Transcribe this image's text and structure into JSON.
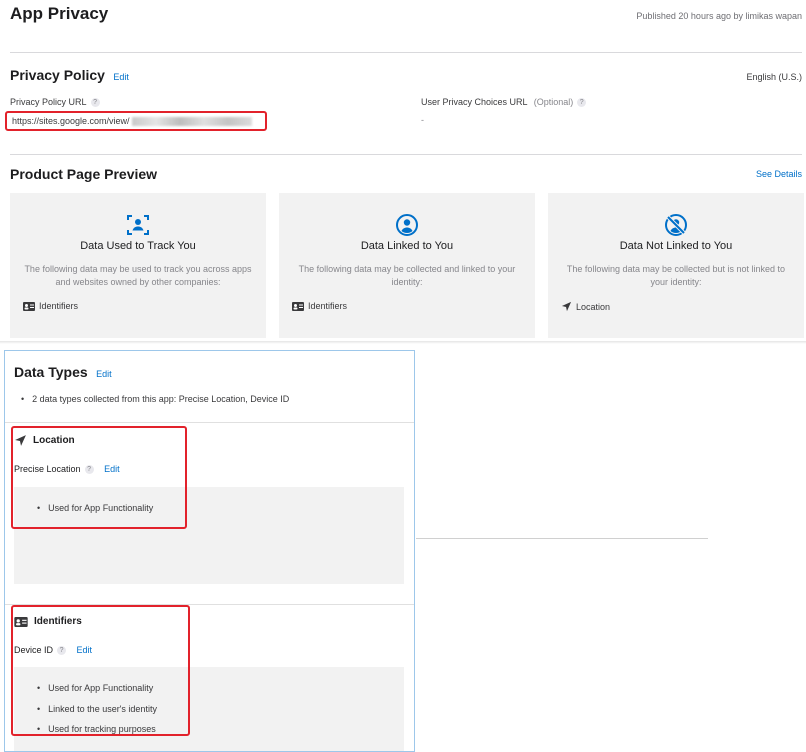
{
  "header": {
    "title": "App Privacy",
    "published": "Published 20 hours ago by limikas wapan"
  },
  "privacy_policy": {
    "heading": "Privacy Policy",
    "edit": "Edit",
    "language": "English (U.S.)",
    "url_label": "Privacy Policy URL",
    "help": "?",
    "url_value": "https://sites.google.com/view/",
    "choices_label": "User Privacy Choices URL",
    "choices_optional": "(Optional)",
    "choices_value": "-"
  },
  "preview": {
    "heading": "Product Page Preview",
    "see_details": "See Details",
    "cards": [
      {
        "title": "Data Used to Track You",
        "desc": "The following data may be used to track you across apps and websites owned by other companies:",
        "item": "Identifiers",
        "icon": "track-icon"
      },
      {
        "title": "Data Linked to You",
        "desc": "The following data may be collected and linked to your identity:",
        "item": "Identifiers",
        "icon": "person-icon"
      },
      {
        "title": "Data Not Linked to You",
        "desc": "The following data may be collected but is not linked to your identity:",
        "item": "Location",
        "icon": "person-slash-icon"
      }
    ]
  },
  "data_types": {
    "heading": "Data Types",
    "edit": "Edit",
    "summary": "2 data types collected from this app: Precise Location, Device ID",
    "location": {
      "heading": "Location",
      "subtype": "Precise Location",
      "help": "?",
      "edit": "Edit",
      "purposes": [
        "Used for App Functionality"
      ]
    },
    "identifiers": {
      "heading": "Identifiers",
      "subtype": "Device ID",
      "help": "?",
      "edit": "Edit",
      "purposes": [
        "Used for App Functionality",
        "Linked to the user's identity",
        "Used for tracking purposes"
      ]
    }
  },
  "colors": {
    "accent": "#0070c9",
    "highlight": "#e2222b",
    "card_bg": "#f2f2f2",
    "panel_border": "#9dc7ea"
  }
}
